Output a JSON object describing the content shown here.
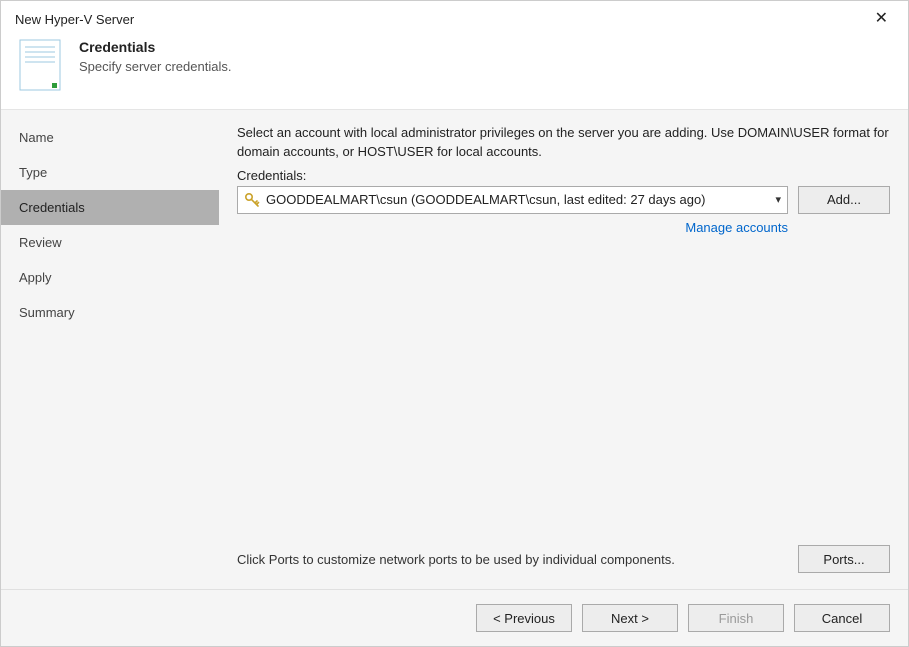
{
  "window": {
    "title": "New Hyper-V Server"
  },
  "header": {
    "title": "Credentials",
    "subtitle": "Specify server credentials."
  },
  "sidebar": {
    "items": [
      {
        "label": "Name"
      },
      {
        "label": "Type"
      },
      {
        "label": "Credentials"
      },
      {
        "label": "Review"
      },
      {
        "label": "Apply"
      },
      {
        "label": "Summary"
      }
    ]
  },
  "content": {
    "description": "Select an account with local administrator privileges on the server you are adding. Use DOMAIN\\USER format for domain accounts, or HOST\\USER for local accounts.",
    "credentials_label": "Credentials:",
    "selected_credential": "GOODDEALMART\\csun (GOODDEALMART\\csun, last edited: 27 days ago)",
    "add_button": "Add...",
    "manage_link": "Manage accounts",
    "ports_text": "Click Ports to customize network ports to be used by individual components.",
    "ports_button": "Ports..."
  },
  "footer": {
    "previous": "< Previous",
    "next": "Next >",
    "finish": "Finish",
    "cancel": "Cancel"
  }
}
